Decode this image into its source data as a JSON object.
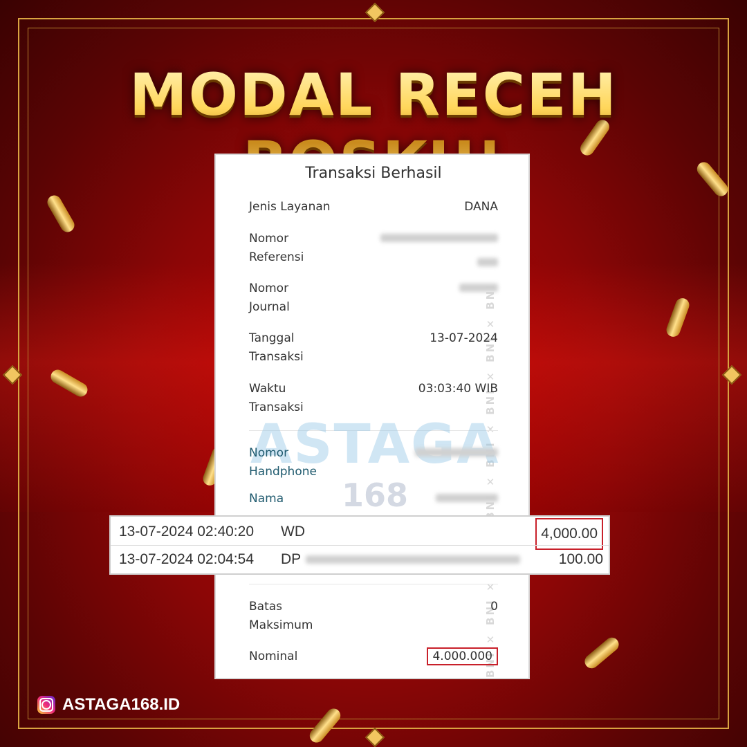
{
  "headline": "MODAL RECEH BOSKU!",
  "receipt": {
    "title": "Transaksi Berhasil",
    "watermark_side": "BNI",
    "rows": [
      {
        "label": "Jenis Layanan",
        "value": "DANA"
      },
      {
        "label": "Nomor Referensi",
        "value": ""
      },
      {
        "label": "Nomor Journal",
        "value": ""
      },
      {
        "label": "Tanggal Transaksi",
        "value": "13-07-2024"
      },
      {
        "label": "Waktu Transaksi",
        "value": "03:03:40 WIB"
      },
      {
        "label": "Nomor Handphone",
        "value": ""
      },
      {
        "label": "Nama",
        "value": ""
      },
      {
        "label": "Batas Maksimum",
        "value": "0"
      },
      {
        "label": "Nominal",
        "value": "4.000.000"
      }
    ],
    "label_lines": {
      "ref1": "Nomor",
      "ref2": "Referensi",
      "jour1": "Nomor",
      "jour2": "Journal",
      "tgl1": "Tanggal",
      "tgl2": "Transaksi",
      "wkt1": "Waktu",
      "wkt2": "Transaksi",
      "hp1": "Nomor",
      "hp2": "Handphone",
      "batas1": "Batas",
      "batas2": "Maksimum"
    }
  },
  "watermark": {
    "brand": "ASTAGA",
    "number": "168"
  },
  "transactions": [
    {
      "datetime": "13-07-2024 02:40:20",
      "type": "WD",
      "amount": "4,000.00"
    },
    {
      "datetime": "13-07-2024 02:04:54",
      "type": "DP",
      "amount": "100.00"
    }
  ],
  "footer": {
    "handle": "ASTAGA168.ID",
    "icon": "instagram-icon"
  },
  "colors": {
    "background": "#8c0606",
    "gold": "#d9a441",
    "highlight_box": "#c8202a"
  }
}
